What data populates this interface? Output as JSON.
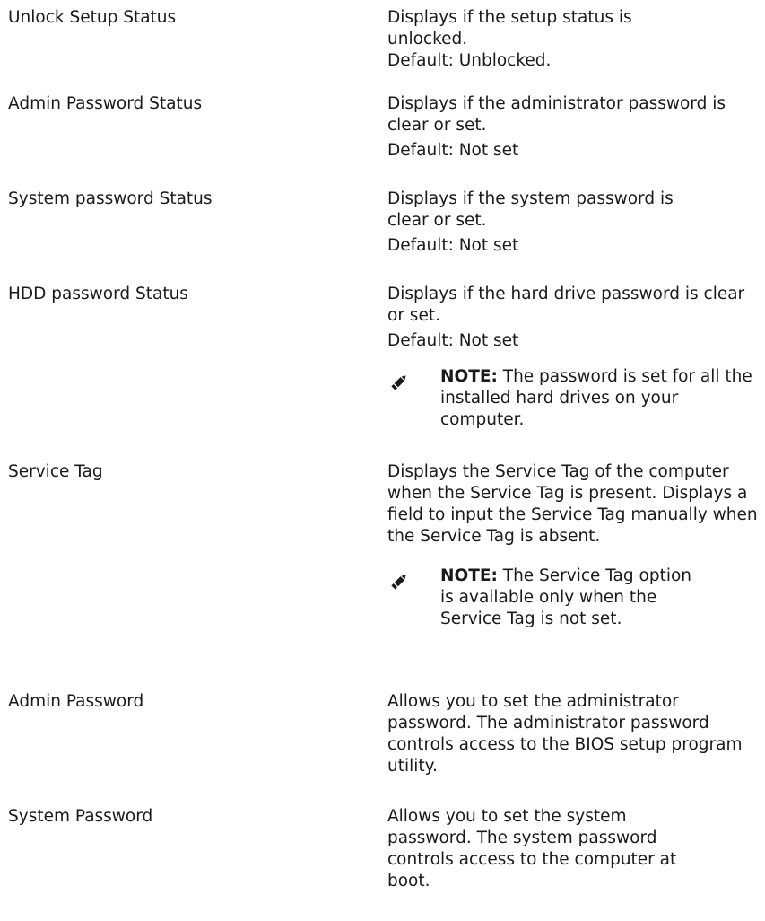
{
  "rows": [
    {
      "label": "Unlock Setup Status",
      "desc": "Displays if the setup status is unlocked.",
      "default": "Default: Unblocked."
    },
    {
      "label": "Admin Password Status",
      "desc": "Displays if the administrator password is clear or set.",
      "default": "Default: Not set"
    },
    {
      "label": "System password Status",
      "desc": "Displays if the system password is clear or set.",
      "default": "Default: Not set"
    },
    {
      "label": "HDD password Status",
      "desc": "Displays if the hard drive password is clear or set.",
      "default": "Default: Not set",
      "note_label": "NOTE:",
      "note_text": "The password is set for all the installed hard drives on your computer."
    },
    {
      "label": "Service Tag",
      "desc": "Displays the Service Tag of the computer when the Service Tag is present. Displays a field to input the Service Tag manually when the Service Tag is absent.",
      "note_label": "NOTE:",
      "note_text": "The Service Tag option is available only when the Service Tag is not set."
    },
    {
      "label": "Admin Password",
      "desc": "Allows you to set the administrator password. The administrator password controls access to the BIOS setup program utility."
    },
    {
      "label": "System Password",
      "desc": "Allows you to set the system password. The system password controls access to the computer at boot."
    }
  ],
  "icons": {
    "note": "pencil-note-icon"
  }
}
